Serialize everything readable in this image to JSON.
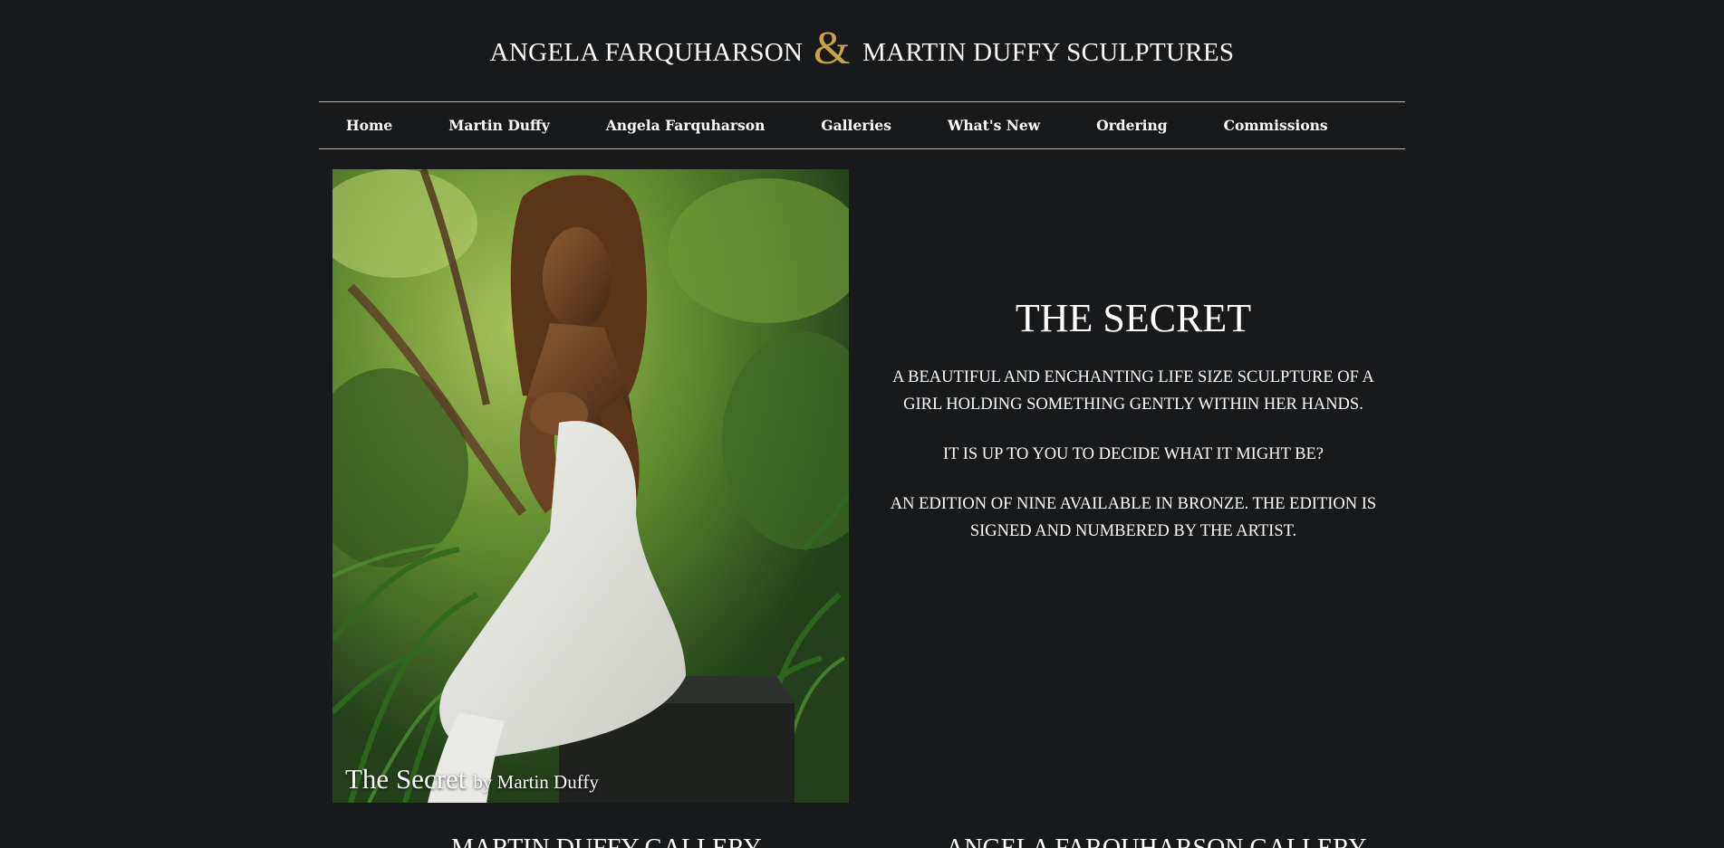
{
  "header": {
    "title_left": "ANGELA FARQUHARSON",
    "ampersand": "&",
    "title_right": "MARTIN DUFFY SCULPTURES",
    "accent_color": "#c9a24a"
  },
  "nav": {
    "items": [
      {
        "label": "Home"
      },
      {
        "label": "Martin Duffy"
      },
      {
        "label": "Angela Farquharson"
      },
      {
        "label": "Galleries"
      },
      {
        "label": "What's New"
      },
      {
        "label": "Ordering"
      },
      {
        "label": "Commissions"
      }
    ]
  },
  "feature": {
    "caption_title": "The Secret",
    "caption_by": "by Martin Duffy"
  },
  "info": {
    "title": "THE SECRET",
    "paragraphs": [
      "A BEAUTIFUL AND ENCHANTING LIFE SIZE SCULPTURE OF A GIRL HOLDING SOMETHING GENTLY WITHIN HER HANDS.",
      "IT IS UP TO YOU TO DECIDE WHAT IT MIGHT BE?",
      "AN EDITION OF NINE AVAILABLE IN BRONZE. THE EDITION IS SIGNED AND NUMBERED BY THE ARTIST."
    ]
  },
  "galleries": {
    "left": "MARTIN DUFFY GALLERY",
    "right": "ANGELA FARQUHARSON GALLERY"
  },
  "colors": {
    "background": "#18191b",
    "text": "#ffffff",
    "divider": "#b9b9b9"
  }
}
